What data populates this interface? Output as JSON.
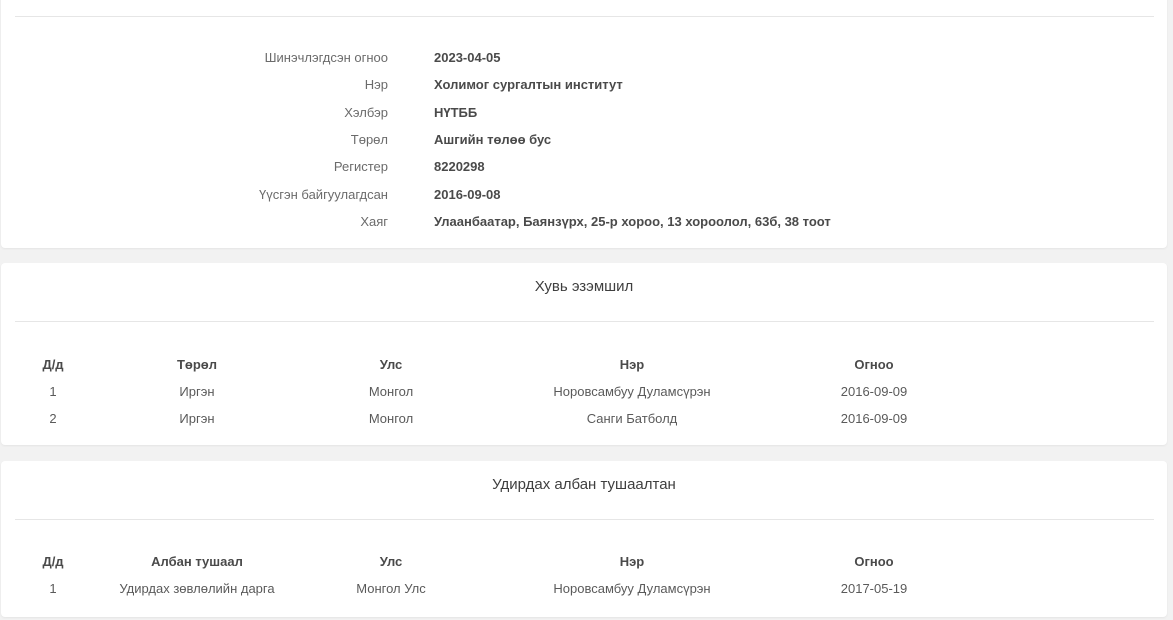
{
  "info": {
    "rows": [
      {
        "label": "Шинэчлэгдсэн огноо",
        "value": "2023-04-05"
      },
      {
        "label": "Нэр",
        "value": "Холимог сургалтын институт"
      },
      {
        "label": "Хэлбэр",
        "value": "НҮТББ"
      },
      {
        "label": "Төрөл",
        "value": "Ашгийн төлөө бус"
      },
      {
        "label": "Регистер",
        "value": "8220298"
      },
      {
        "label": "Үүсгэн байгуулагдсан",
        "value": "2016-09-08"
      },
      {
        "label": "Хаяг",
        "value": "Улаанбаатар, Баянзүрх, 25-р хороо, 13 хороолол, 63б, 38 тоот"
      }
    ]
  },
  "owners": {
    "title": "Хувь эзэмшил",
    "columns": [
      "Д/д",
      "Төрөл",
      "Улс",
      "Нэр",
      "Огноо"
    ],
    "rows": [
      [
        "1",
        "Иргэн",
        "Монгол",
        "Норовсамбуу Дуламсүрэн",
        "2016-09-09"
      ],
      [
        "2",
        "Иргэн",
        "Монгол",
        "Санги Батболд",
        "2016-09-09"
      ]
    ]
  },
  "officials": {
    "title": "Удирдах албан тушаалтан",
    "columns": [
      "Д/д",
      "Албан тушаал",
      "Улс",
      "Нэр",
      "Огноо"
    ],
    "rows": [
      [
        "1",
        "Удирдах зөвлөлийн дарга",
        "Монгол Улс",
        "Норовсамбуу Дуламсүрэн",
        "2017-05-19"
      ]
    ]
  }
}
